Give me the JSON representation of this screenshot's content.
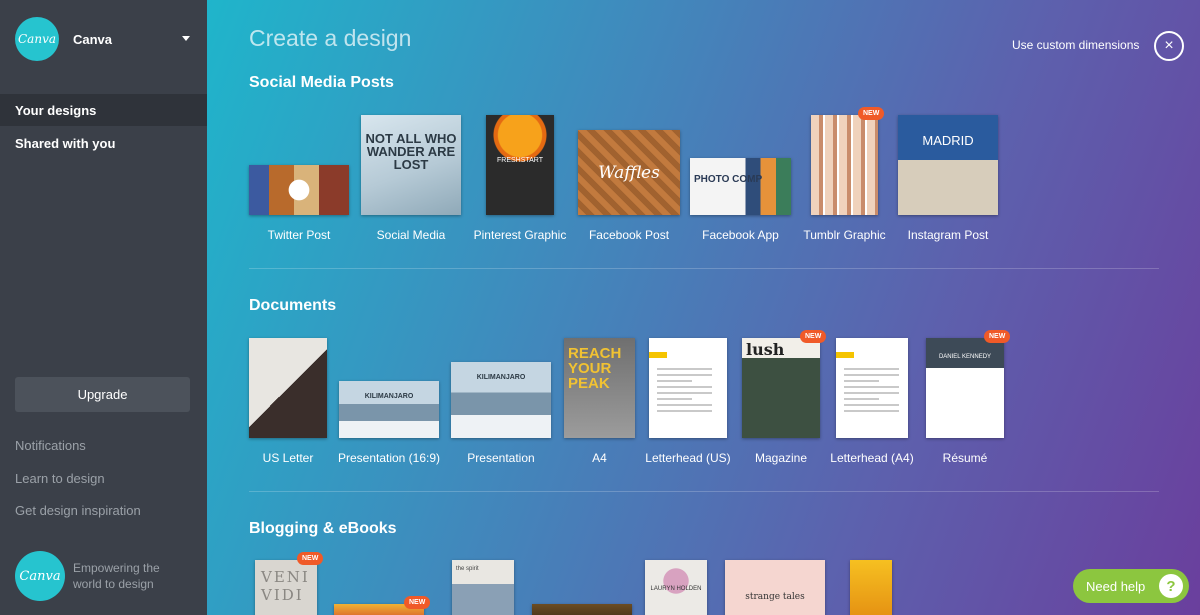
{
  "sidebar": {
    "brand_logo_text": "Canva",
    "brand_name": "Canva",
    "nav": [
      "Your designs",
      "Shared with you"
    ],
    "upgrade_label": "Upgrade",
    "links": [
      "Notifications",
      "Learn to design",
      "Get design inspiration"
    ],
    "footer_logo_text": "Canva",
    "tagline": "Empowering the world to design"
  },
  "main": {
    "title": "Create a design",
    "custom_dimensions": "Use custom dimensions",
    "close_icon": "×",
    "new_badge": "NEW"
  },
  "sections": {
    "social": {
      "title": "Social Media Posts",
      "items": [
        {
          "label": "Twitter Post",
          "art": "food",
          "new": false
        },
        {
          "label": "Social Media",
          "art": "snow",
          "text": "NOT ALL WHO WANDER ARE LOST",
          "new": false
        },
        {
          "label": "Pinterest Graphic",
          "art": "orange",
          "text": "FRESHSTART",
          "new": false
        },
        {
          "label": "Facebook Post",
          "art": "waffle",
          "text": "Waffles",
          "new": false
        },
        {
          "label": "Facebook App",
          "art": "photo",
          "text": "PHOTO COMP",
          "new": false
        },
        {
          "label": "Tumblr Graphic",
          "art": "tumblr",
          "new": true
        },
        {
          "label": "Instagram Post",
          "art": "madrid",
          "text": "MADRID",
          "new": false
        }
      ]
    },
    "documents": {
      "title": "Documents",
      "items": [
        {
          "label": "US Letter",
          "art": "letter",
          "new": false
        },
        {
          "label": "Presentation (16:9)",
          "art": "mountain",
          "text": "KILIMANJARO",
          "new": false
        },
        {
          "label": "Presentation",
          "art": "mountain",
          "text": "KILIMANJARO",
          "new": false
        },
        {
          "label": "A4",
          "art": "a4",
          "text": "REACH YOUR PEAK",
          "new": false
        },
        {
          "label": "Letterhead (US)",
          "art": "doc",
          "new": false
        },
        {
          "label": "Magazine",
          "art": "mag",
          "text": "lush",
          "new": true
        },
        {
          "label": "Letterhead (A4)",
          "art": "doc",
          "new": false
        },
        {
          "label": "Résumé",
          "art": "resume",
          "text": "DANIEL KENNEDY",
          "new": true
        }
      ]
    },
    "blogging": {
      "title": "Blogging & eBooks",
      "items": [
        {
          "art": "veni",
          "text": "VENI VIDI",
          "new": true
        },
        {
          "art": "book2",
          "new": true
        },
        {
          "art": "book3",
          "text": "the spirit",
          "new": false
        },
        {
          "art": "book4",
          "new": false
        },
        {
          "art": "book5",
          "text": "LAURYN HOLDEN",
          "new": false
        },
        {
          "art": "book6",
          "text": "strange tales",
          "new": false
        },
        {
          "art": "book7",
          "new": false
        }
      ]
    }
  },
  "help": {
    "label": "Need help",
    "icon": "?"
  }
}
